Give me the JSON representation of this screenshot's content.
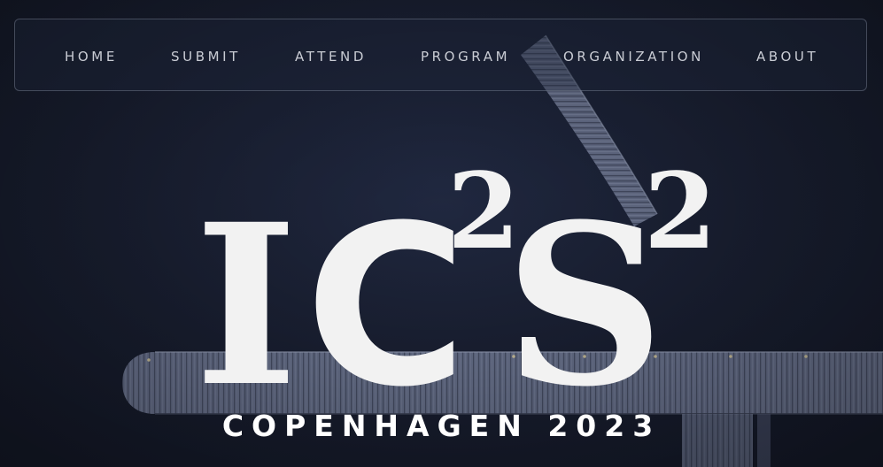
{
  "nav": {
    "items": [
      {
        "label": "HOME"
      },
      {
        "label": "SUBMIT"
      },
      {
        "label": "ATTEND"
      },
      {
        "label": "PROGRAM"
      },
      {
        "label": "ORGANIZATION"
      },
      {
        "label": "ABOUT"
      }
    ]
  },
  "hero": {
    "logo_letter_1": "I",
    "logo_letter_2": "C",
    "logo_exp_1": "2",
    "logo_letter_3": "S",
    "logo_exp_2": "2",
    "subtitle": "COPENHAGEN 2023"
  },
  "colors": {
    "background": "#1b2235",
    "logo": "#f2f2f2",
    "nav_text": "#c9ccd4",
    "pier": "#8a93b0"
  },
  "icons": {
    "background": "aerial-pier-photo"
  }
}
